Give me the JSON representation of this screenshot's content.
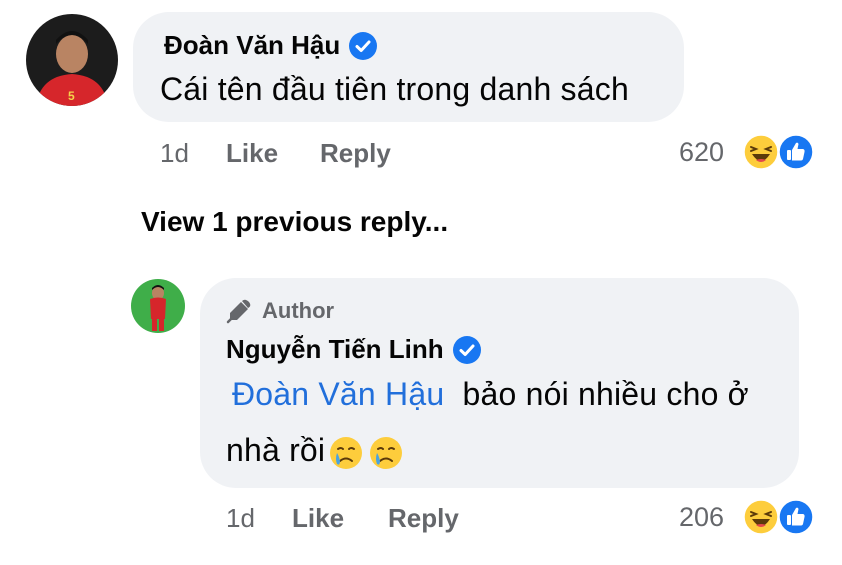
{
  "comment": {
    "author": "Đoàn Văn Hậu",
    "text": "Cái tên đầu tiên trong danh sách",
    "time": "1d",
    "like_label": "Like",
    "reply_label": "Reply",
    "reaction_count": "620",
    "reactions": [
      "haha-icon",
      "like-icon"
    ]
  },
  "view_previous_label": "View 1 previous reply...",
  "reply": {
    "badge": "Author",
    "author": "Nguyễn Tiến Linh",
    "mention": "Đoàn Văn Hậu",
    "text_line1": "bảo nói nhiều cho ở",
    "text_line2": "nhà rồi",
    "inline_emojis": [
      "crying-face-icon",
      "crying-face-icon"
    ],
    "time": "1d",
    "like_label": "Like",
    "reply_label": "Reply",
    "reaction_count": "206",
    "reactions": [
      "haha-icon",
      "like-icon"
    ]
  },
  "colors": {
    "bubble": "#f0f2f5",
    "verified": "#1877f2",
    "mention": "#216fdb",
    "meta": "#65676b",
    "avatar1_bg": "#1c1c1c",
    "avatar2_bg": "#3fae49"
  }
}
